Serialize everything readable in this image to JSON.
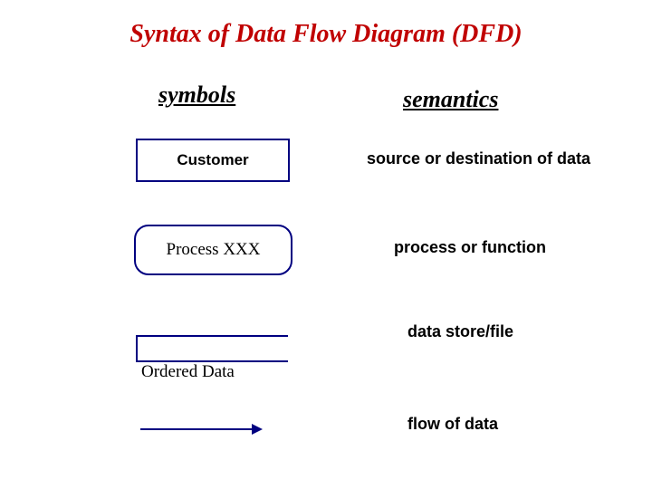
{
  "title": "Syntax of Data Flow Diagram (DFD)",
  "headers": {
    "symbols": "symbols",
    "semantics": "semantics"
  },
  "rows": [
    {
      "symbol_label": "Customer",
      "semantic": "source or destination of data"
    },
    {
      "symbol_label": "Process XXX",
      "semantic": "process or function"
    },
    {
      "symbol_label": "Ordered Data",
      "semantic": "data store/file"
    },
    {
      "symbol_label": "",
      "semantic": "flow of data"
    }
  ],
  "colors": {
    "title": "#c00000",
    "symbol_border": "#000080"
  }
}
